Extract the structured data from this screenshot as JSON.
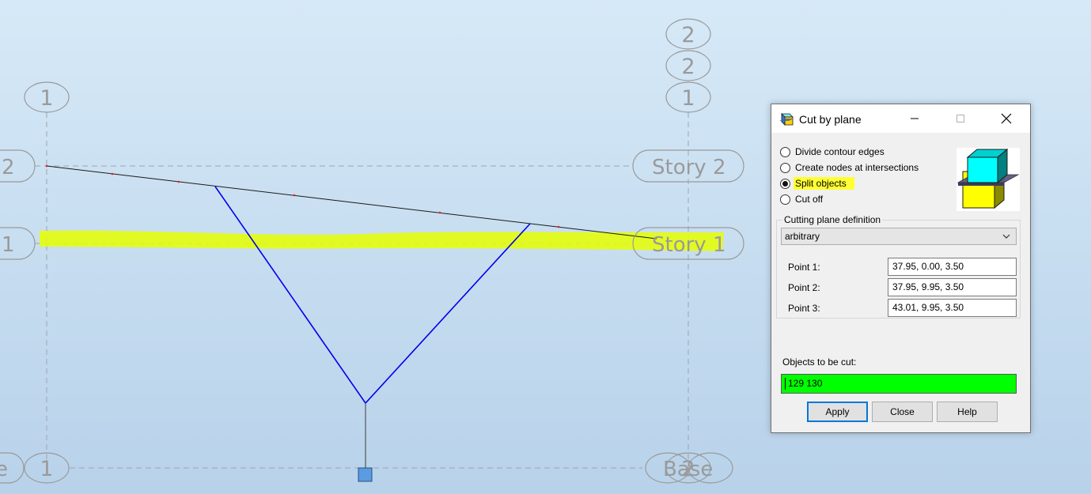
{
  "viewport": {
    "grid_bubbles": [
      "2",
      "2",
      "1",
      "1",
      "2",
      "1",
      "1",
      "1",
      "2"
    ],
    "level_labels": {
      "story2_left": "2",
      "story2_right": "Story 2",
      "story1_left": "1",
      "story1_right": "Story 1",
      "base_left": "e",
      "base_right": "Base"
    },
    "highlight_color": "#e6ff00",
    "member_color": "#0000ee"
  },
  "dialog": {
    "title": "Cut by plane",
    "icon": "cut-by-plane-icon",
    "options": [
      {
        "label": "Divide contour edges",
        "checked": false
      },
      {
        "label": "Create nodes at intersections",
        "checked": false
      },
      {
        "label": "Split objects",
        "checked": true
      },
      {
        "label": "Cut off",
        "checked": false
      }
    ],
    "cutting_plane": {
      "group_label": "Cutting plane definition",
      "selected": "arbitrary"
    },
    "points": [
      {
        "label": "Point 1:",
        "value": "37.95, 0.00, 3.50"
      },
      {
        "label": "Point 2:",
        "value": "37.95, 9.95, 3.50"
      },
      {
        "label": "Point 3:",
        "value": "43.01, 9.95, 3.50"
      }
    ],
    "objects_label": "Objects to be cut:",
    "objects_value": "129 130",
    "buttons": {
      "apply": "Apply",
      "close": "Close",
      "help": "Help"
    },
    "objects_field_color": "#00ff00",
    "highlight_color": "#ffff33"
  }
}
